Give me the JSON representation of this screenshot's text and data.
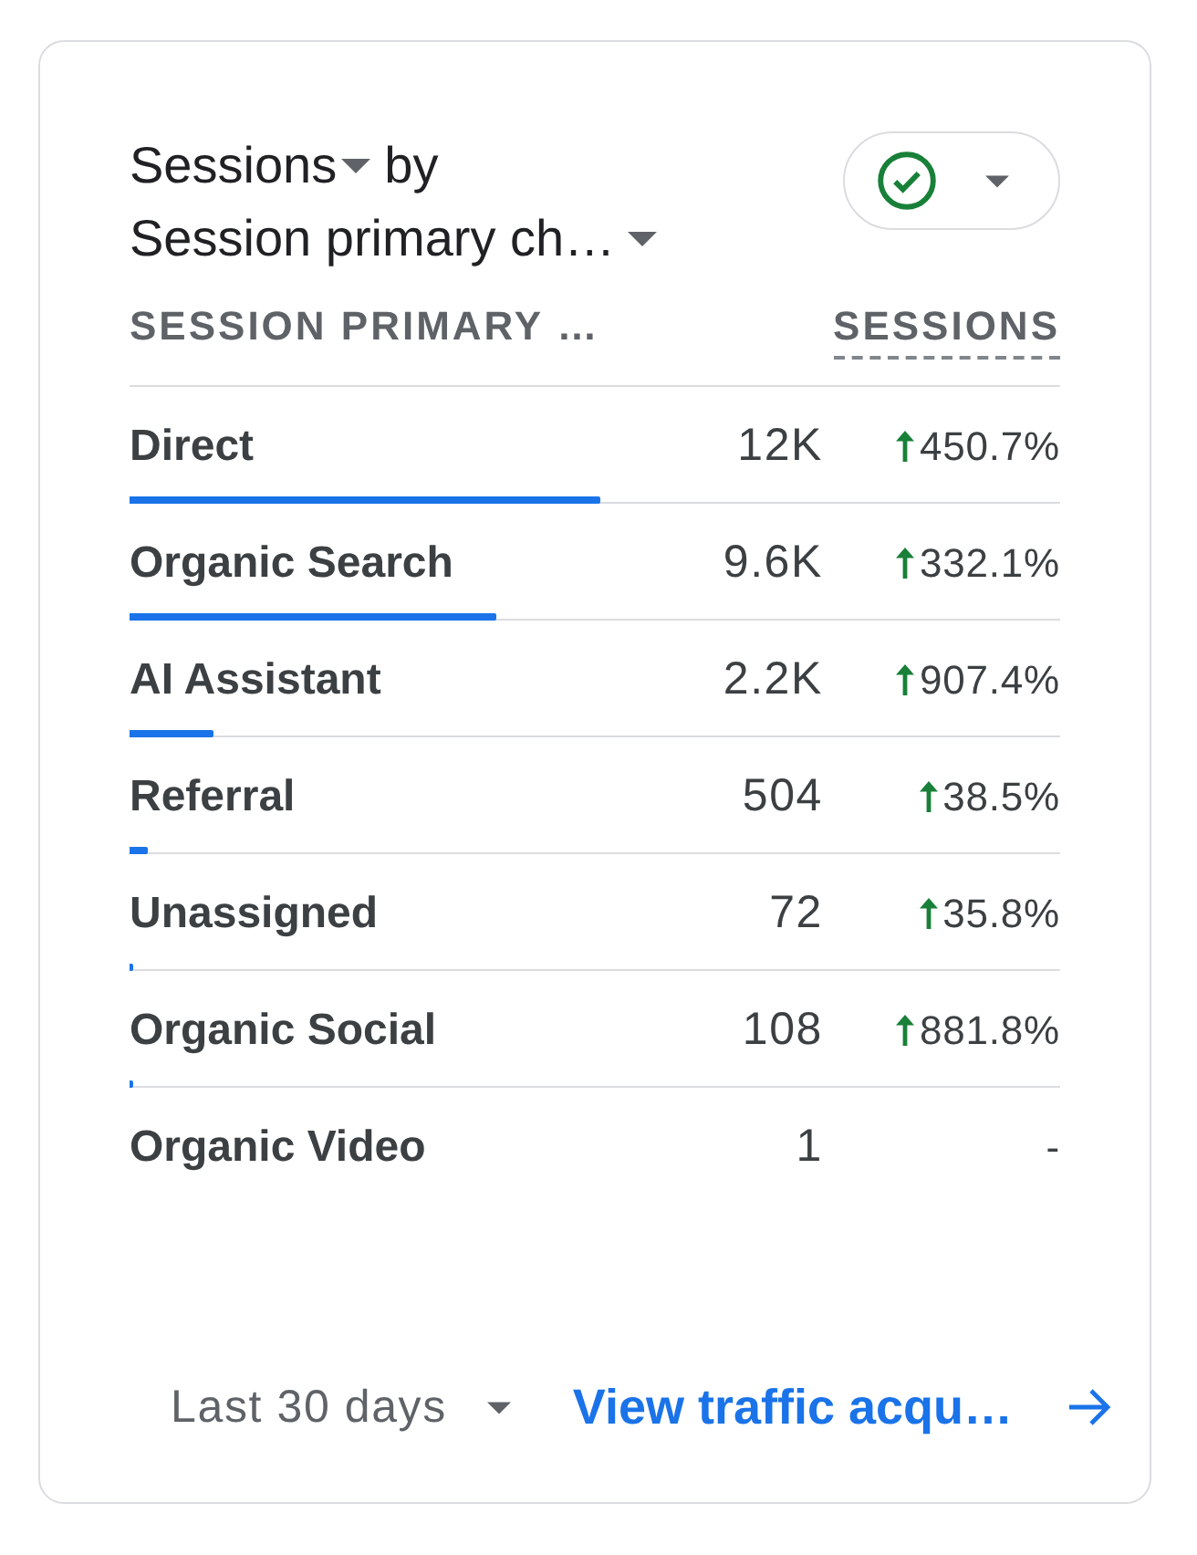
{
  "title": {
    "metric": "Sessions",
    "connector": "by",
    "dimension": "Session primary ch…"
  },
  "table": {
    "columns": [
      {
        "label": "SESSION PRIMARY …",
        "kind": "dimension"
      },
      {
        "label": "SESSIONS",
        "kind": "metric"
      }
    ],
    "rows": [
      {
        "name": "Direct",
        "value": "12K",
        "increase": true,
        "change": "450.7%",
        "level": 0.506
      },
      {
        "name": "Organic Search",
        "value": "9.6K",
        "increase": true,
        "change": "332.1%",
        "level": 0.394
      },
      {
        "name": "AI Assistant",
        "value": "2.2K",
        "increase": true,
        "change": "907.4%",
        "level": 0.09
      },
      {
        "name": "Referral",
        "value": "504",
        "increase": true,
        "change": "38.5%",
        "level": 0.02
      },
      {
        "name": "Unassigned",
        "value": "72",
        "increase": true,
        "change": "35.8%",
        "level": 0.003
      },
      {
        "name": "Organic Social",
        "value": "108",
        "increase": true,
        "change": "881.8%",
        "level": 0.004
      },
      {
        "name": "Organic Video",
        "value": "1",
        "increase": false,
        "change": "-"
      }
    ]
  },
  "footer": {
    "date_range": "Last 30 days",
    "link": "View traffic acqu…"
  }
}
